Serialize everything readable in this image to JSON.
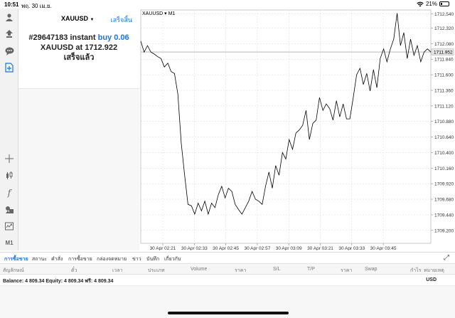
{
  "status_bar": {
    "time": "10:51",
    "date": "พฤ. 30 เม.ย.",
    "battery": "21%"
  },
  "toolbar": {
    "icons": [
      "account-icon",
      "trade-icon",
      "chat-icon",
      "new-order-icon",
      "crosshair-icon",
      "candles-icon",
      "function-icon",
      "objects-icon",
      "timeframe-icon"
    ],
    "timeframe_label": "M1"
  },
  "trade_panel": {
    "symbol": "XAUUSD",
    "symbol_arrow": "▼",
    "done_label": "เสร็จสิ้น",
    "line1_prefix": "#29647183 instant ",
    "line1_action": "buy 0.06",
    "line2_prefix": "XAUUSD at ",
    "line2_price": "1712.922",
    "line3": "เสร็จแล้ว"
  },
  "chart": {
    "title": "XAUUSD ▾ M1",
    "current_price_label": "1711.952"
  },
  "chart_data": {
    "type": "line",
    "symbol": "XAUUSD",
    "timeframe": "M1",
    "current_price": 1711.952,
    "ylim": [
      1709.0,
      1712.6
    ],
    "y_ticks": [
      "1712.540",
      "1712.320",
      "1712.080",
      "1711.840",
      "1711.600",
      "1711.360",
      "1711.120",
      "1710.880",
      "1710.640",
      "1710.400",
      "1710.160",
      "1709.920",
      "1709.680",
      "1709.440",
      "1709.200"
    ],
    "x_ticks": [
      "30 Apr 02:21",
      "30 Apr 02:33",
      "30 Apr 02:45",
      "30 Apr 02:57",
      "30 Apr 03:09",
      "30 Apr 03:21",
      "30 Apr 03:33",
      "30 Apr 03:45"
    ],
    "grid": true,
    "values": [
      1712.12,
      1711.95,
      1712.05,
      1711.95,
      1711.92,
      1711.88,
      1711.85,
      1711.72,
      1711.78,
      1711.65,
      1711.62,
      1711.3,
      1710.55,
      1710.05,
      1709.6,
      1709.58,
      1709.45,
      1709.62,
      1709.5,
      1709.65,
      1709.45,
      1709.62,
      1709.55,
      1709.75,
      1709.88,
      1709.7,
      1709.85,
      1709.8,
      1709.6,
      1709.52,
      1709.45,
      1709.55,
      1709.65,
      1709.8,
      1709.68,
      1709.65,
      1709.6,
      1709.88,
      1710.1,
      1709.85,
      1710.2,
      1710.05,
      1710.4,
      1710.3,
      1710.6,
      1710.45,
      1710.7,
      1710.75,
      1710.82,
      1711.05,
      1710.6,
      1710.85,
      1710.9,
      1711.25,
      1711.05,
      1711.15,
      1711.08,
      1710.9,
      1711.2,
      1710.95,
      1711.15,
      1710.92,
      1710.92,
      1711.25,
      1711.6,
      1711.7,
      1711.45,
      1711.62,
      1711.35,
      1711.68,
      1711.4,
      1711.85,
      1712.0,
      1711.8,
      1712.0,
      1712.15,
      1712.55,
      1712.05,
      1712.25,
      1711.85,
      1712.15,
      1711.9,
      1712.05,
      1711.8,
      1711.95,
      1712.0,
      1711.95
    ],
    "colors": {
      "line": "#000000",
      "grid": "#dadada",
      "price_line": "#8c8c8c",
      "price_label_bg": "#e6e6e6"
    }
  },
  "bottom_tabs": {
    "items": [
      "การซื้อขาย",
      "สถานะ",
      "คำสั่ง",
      "การซื้อขาย",
      "กล่องจดหมาย",
      "ข่าว",
      "บันทึก",
      "เกี่ยวกับ"
    ],
    "active_index": 0
  },
  "columns": [
    "สัญลักษณ์",
    "ตั๋ว",
    "เวลา",
    "ประเภท",
    "Volume",
    "ราคา",
    "S/L",
    "T/P",
    "ราคา",
    "Swap",
    "กำไร",
    "หมายเหตุ"
  ],
  "balance": {
    "text": "Balance: 4 809.34 Equity: 4 809.34 ฟรี: 4 809.34",
    "currency": "USD"
  },
  "theme": {
    "accent": "#1a73e8"
  }
}
